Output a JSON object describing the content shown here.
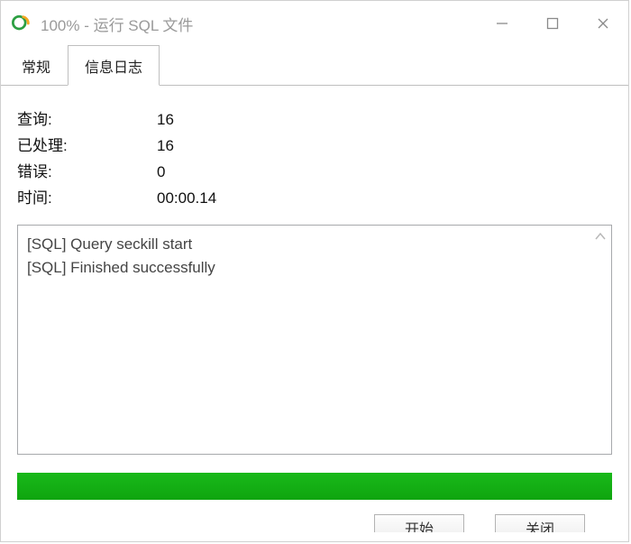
{
  "titlebar": {
    "title": "100% - 运行 SQL 文件"
  },
  "tabs": {
    "general": "常规",
    "log": "信息日志"
  },
  "stats": {
    "query_label": "查询:",
    "query_value": "16",
    "processed_label": "已处理:",
    "processed_value": "16",
    "errors_label": "错误:",
    "errors_value": "0",
    "time_label": "时间:",
    "time_value": "00:00.14"
  },
  "log": {
    "line1": "[SQL] Query seckill start",
    "line2": "[SQL] Finished successfully"
  },
  "buttons": {
    "start": "开始",
    "close": "关闭"
  }
}
